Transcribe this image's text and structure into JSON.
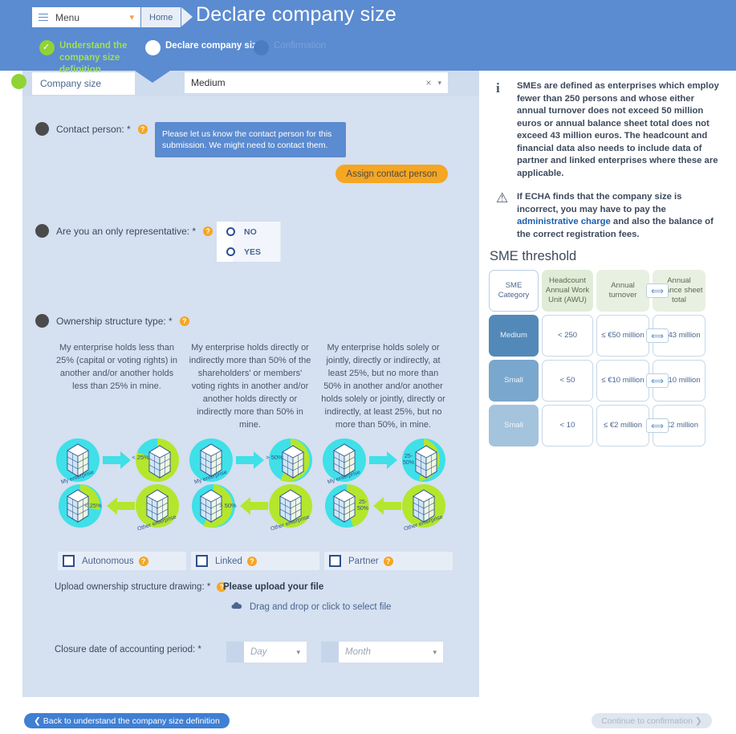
{
  "header": {
    "menu_label": "Menu",
    "breadcrumb_home": "Home",
    "page_title": "Declare company size"
  },
  "stepper": [
    {
      "label": "Understand the company size definition",
      "state": "done"
    },
    {
      "label": "Declare company size",
      "state": "current"
    },
    {
      "label": "Confirmation",
      "state": "future"
    }
  ],
  "company_size_row": {
    "label": "Company size",
    "value": "Medium",
    "clear_icon": "×",
    "caret_icon": "▾"
  },
  "contact": {
    "label": "Contact person: *",
    "required": "*",
    "tooltip": "Please let us know the contact person for this submission. We might need to contact them.",
    "assign_button": "Assign contact person"
  },
  "only_representative": {
    "label": "Are you an only representative: *",
    "options": [
      "NO",
      "YES"
    ]
  },
  "ownership": {
    "label": "Ownership structure type: *",
    "descriptions": [
      "My enterprise holds less than 25% (capital or voting rights) in another and/or another holds less than 25% in mine.",
      "My enterprise holds directly or indirectly more than 50% of the shareholders' or members' voting rights in another and/or another holds directly or indirectly more than 50% in mine.",
      "My enterprise holds solely or jointly, directly or indirectly, at least 25%, but no more than 50% in another and/or another holds solely or jointly, directly or indirectly, at least 25%, but no more than 50%, in mine."
    ],
    "diagrams": [
      {
        "my_label": "My enterprise",
        "other_label": "Other enterprise",
        "top_pct": "< 25%",
        "bottom_pct": "< 25%"
      },
      {
        "my_label": "My enterprise",
        "other_label": "Other enterprise",
        "top_pct": "> 50%",
        "bottom_pct": "> 50%"
      },
      {
        "my_label": "My enterprise",
        "other_label": "Other enterprise",
        "top_pct": "25-50%",
        "bottom_pct": "25-50%"
      }
    ],
    "checkboxes": [
      "Autonomous",
      "Linked",
      "Partner"
    ]
  },
  "upload": {
    "label": "Upload ownership structure drawing: *",
    "title": "Please upload your file",
    "drop_text": "Drag and drop or click to select file",
    "icon": "upload-cloud-icon"
  },
  "closure": {
    "label": "Closure date of accounting period: *",
    "day_placeholder": "Day",
    "month_placeholder": "Month",
    "caret_icon": "▾"
  },
  "info_panel": [
    {
      "icon": "info-icon",
      "glyph": "i",
      "text": "SMEs are defined as enterprises which employ fewer than 250 persons and whose either annual turnover does not exceed 50 million euros or annual balance sheet total does not exceed 43 million euros. The headcount and financial data also needs to include data of partner and linked enterprises where these are applicable."
    },
    {
      "icon": "warning-icon",
      "glyph": "⚠",
      "text_before": "If ECHA finds that the company size is incorrect, you may have to pay the ",
      "link": "administrative charge",
      "text_after": " and also the balance of the correct registration fees."
    }
  ],
  "sme_threshold": {
    "title": "SME threshold",
    "headers": [
      "SME Category",
      "Headcount Annual Work Unit (AWU)",
      "Annual turnover",
      "Annual balance sheet total"
    ],
    "separator_icon": "or-arrows-icon",
    "rows": [
      {
        "category": "Medium",
        "headcount": "< 250",
        "turnover": "≤ €50 million",
        "balance": "≤ €43 million"
      },
      {
        "category": "Small",
        "headcount": "< 50",
        "turnover": "≤ €10 million",
        "balance": "≤ €10 million"
      },
      {
        "category": "Small",
        "headcount": "< 10",
        "turnover": "≤ €2 million",
        "balance": "≤ €2 million"
      }
    ]
  },
  "footer": {
    "back_label": "Back to understand the company size definition",
    "back_icon": "❮",
    "continue_label": "Continue to confirmation",
    "continue_icon": "❯"
  },
  "colors": {
    "header_blue": "#5b8bd0",
    "panel_blue": "#d5e0f0",
    "accent_orange": "#f5a623",
    "step_green": "#8fd434",
    "link_blue": "#1b5fae"
  }
}
